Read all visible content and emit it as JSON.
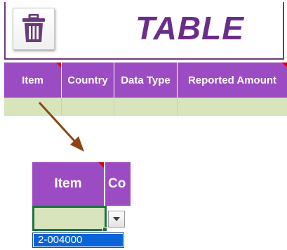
{
  "banner": {
    "title": "TABLE",
    "delete_button_icon": "trash-icon"
  },
  "table": {
    "columns": [
      "Item",
      "Country",
      "Data Type",
      "Reported Amount"
    ]
  },
  "zoom": {
    "columns": [
      "Item",
      "Co"
    ],
    "dropdown_icon": "chevron-down-icon",
    "dropdown_options": [
      "2-004000"
    ]
  },
  "colors": {
    "header_bg": "#9b4cc2",
    "data_row_bg": "#d8e4bc",
    "title_text": "#6b2d8a",
    "arrow": "#8b4513",
    "selected_option_bg": "#0a64d8",
    "comment_marker": "#e00000"
  }
}
